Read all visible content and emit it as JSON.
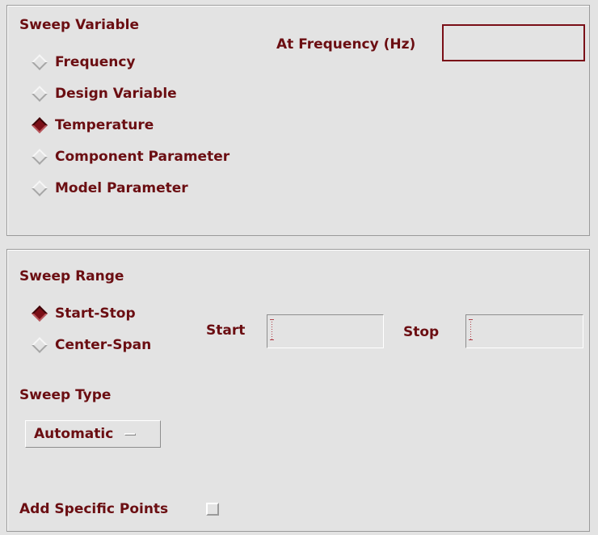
{
  "sweep_variable": {
    "heading": "Sweep Variable",
    "options": [
      {
        "label": "Frequency",
        "selected": false
      },
      {
        "label": "Design Variable",
        "selected": false
      },
      {
        "label": "Temperature",
        "selected": true
      },
      {
        "label": "Component Parameter",
        "selected": false
      },
      {
        "label": "Model Parameter",
        "selected": false
      }
    ],
    "at_frequency": {
      "label": "At Frequency (Hz)",
      "value": ""
    }
  },
  "sweep_range": {
    "heading": "Sweep Range",
    "options": [
      {
        "label": "Start-Stop",
        "selected": true
      },
      {
        "label": "Center-Span",
        "selected": false
      }
    ],
    "start": {
      "label": "Start",
      "value": ""
    },
    "stop": {
      "label": "Stop",
      "value": ""
    }
  },
  "sweep_type": {
    "heading": "Sweep Type",
    "selected_value": "Automatic"
  },
  "add_specific_points": {
    "label": "Add Specific Points",
    "checked": false
  },
  "colors": {
    "text": "#6b0e12",
    "background": "#e3e3e3",
    "accent": "#7a0f17"
  }
}
